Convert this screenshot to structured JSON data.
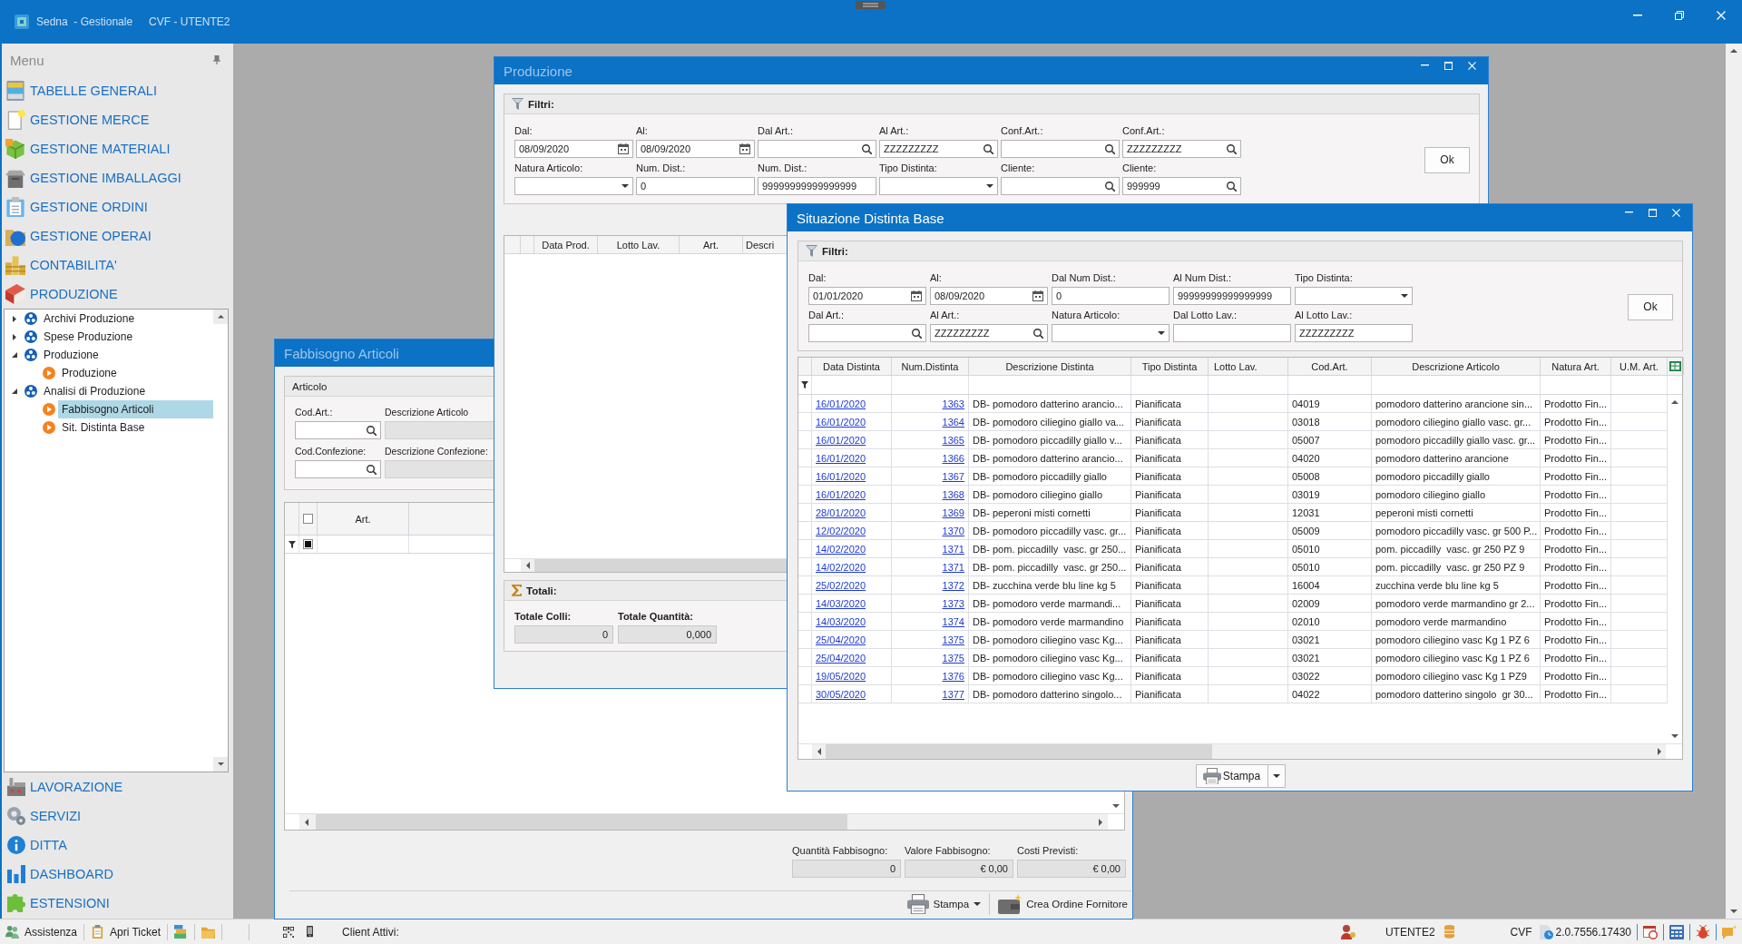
{
  "app_bar": {
    "title": "Sedna  - Gestionale",
    "context": "CVF - UTENTE2"
  },
  "menu": {
    "title": "Menu",
    "sections": [
      "TABELLE GENERALI",
      "GESTIONE MERCE",
      "GESTIONE MATERIALI",
      "GESTIONE IMBALLAGGI",
      "GESTIONE ORDINI",
      "GESTIONE OPERAI",
      "CONTABILITA'",
      "PRODUZIONE"
    ],
    "tree": [
      {
        "label": "Archivi Produzione",
        "kind": "group",
        "expanded": false,
        "selected": false
      },
      {
        "label": "Spese Produzione",
        "kind": "group",
        "expanded": false,
        "selected": false
      },
      {
        "label": "Produzione",
        "kind": "group",
        "expanded": true,
        "selected": false,
        "children": [
          {
            "label": "Produzione",
            "kind": "form",
            "selected": false
          }
        ]
      },
      {
        "label": "Analisi di Produzione",
        "kind": "group",
        "expanded": true,
        "selected": false,
        "children": [
          {
            "label": "Fabbisogno Articoli",
            "kind": "form",
            "selected": true
          },
          {
            "label": "Sit. Distinta Base",
            "kind": "form",
            "selected": false
          }
        ]
      }
    ],
    "more_sections": [
      "LAVORAZIONE",
      "SERVIZI",
      "DITTA",
      "DASHBOARD",
      "ESTENSIONI"
    ]
  },
  "produzione_window": {
    "title": "Produzione",
    "active": false,
    "filters": {
      "title": "Filtri:",
      "fields": [
        {
          "label": "Dal:",
          "value": "08/09/2020",
          "kind": "date"
        },
        {
          "label": "Al:",
          "value": "08/09/2020",
          "kind": "date"
        },
        {
          "label": "Dal Art.:",
          "kind": "search"
        },
        {
          "label": "Al Art.:",
          "value": "ZZZZZZZZZ",
          "kind": "search"
        },
        {
          "label": "Conf.Art.:",
          "kind": "search"
        },
        {
          "label": "Conf.Art.:",
          "value": "ZZZZZZZZZ",
          "kind": "search"
        },
        {
          "label": "Natura Articolo:",
          "kind": "dropdown"
        },
        {
          "label": "Num. Dist.:",
          "value": "0",
          "kind": "text"
        },
        {
          "label": "Num. Dist.:",
          "value": "99999999999999999",
          "kind": "text"
        },
        {
          "label": "Tipo Distinta:",
          "kind": "dropdown"
        },
        {
          "label": "Cliente:",
          "kind": "search"
        },
        {
          "label": "Cliente:",
          "value": "999999",
          "kind": "search"
        }
      ]
    },
    "ok_button": "Ok",
    "grid": {
      "columns": [
        "Data Prod.",
        "Lotto Lav.",
        "Art.",
        "Descri"
      ]
    },
    "totals": {
      "title": "Totali:",
      "fields": [
        {
          "label": "Totale Colli:",
          "value": "0"
        },
        {
          "label": "Totale Quantità:",
          "value": "0,000"
        }
      ]
    }
  },
  "situazione_window": {
    "title": "Situazione Distinta Base",
    "active": true,
    "filters": {
      "title": "Filtri:",
      "fields": [
        {
          "label": "Dal:",
          "value": "01/01/2020",
          "kind": "date"
        },
        {
          "label": "Al:",
          "value": "08/09/2020",
          "kind": "date"
        },
        {
          "label": "Dal Num Dist.:",
          "value": "0",
          "kind": "text"
        },
        {
          "label": "Al Num Dist.:",
          "value": "99999999999999999",
          "kind": "text"
        },
        {
          "label": "Tipo Distinta:",
          "kind": "dropdown"
        },
        {
          "label": "Dal Art.:",
          "kind": "search"
        },
        {
          "label": "Al Art.:",
          "value": "ZZZZZZZZZ",
          "kind": "search"
        },
        {
          "label": "Natura Articolo:",
          "kind": "dropdown"
        },
        {
          "label": "Dal Lotto Lav.:",
          "kind": "text"
        },
        {
          "label": "Al Lotto Lav.:",
          "value": "ZZZZZZZZZ",
          "kind": "text"
        }
      ]
    },
    "ok_button": "Ok",
    "grid": {
      "columns": [
        "Data Distinta",
        "Num.Distinta",
        "Descrizione Distinta",
        "Tipo Distinta",
        "Lotto Lav.",
        "Cod.Art.",
        "Descrizione Articolo",
        "Natura Art.",
        "U.M. Art."
      ],
      "rows": [
        {
          "data": "16/01/2020",
          "num": "1363",
          "descrizione": "DB- pomodoro datterino arancio...",
          "tipo": "Pianificata",
          "cod_art": "04019",
          "descrizione_articolo": "pomodoro datterino arancione sin...",
          "natura": "Prodotto Fin..."
        },
        {
          "data": "16/01/2020",
          "num": "1364",
          "descrizione": "DB- pomodoro ciliegino giallo va...",
          "tipo": "Pianificata",
          "cod_art": "03018",
          "descrizione_articolo": "pomodoro ciliegino giallo vasc. gr...",
          "natura": "Prodotto Fin..."
        },
        {
          "data": "16/01/2020",
          "num": "1365",
          "descrizione": "DB- pomodoro piccadilly giallo v...",
          "tipo": "Pianificata",
          "cod_art": "05007",
          "descrizione_articolo": "pomodoro piccadilly giallo vasc. gr...",
          "natura": "Prodotto Fin..."
        },
        {
          "data": "16/01/2020",
          "num": "1366",
          "descrizione": "DB- pomodoro datterino arancio...",
          "tipo": "Pianificata",
          "cod_art": "04020",
          "descrizione_articolo": "pomodoro datterino arancione",
          "natura": "Prodotto Fin..."
        },
        {
          "data": "16/01/2020",
          "num": "1367",
          "descrizione": "DB- pomodoro piccadilly giallo",
          "tipo": "Pianificata",
          "cod_art": "05008",
          "descrizione_articolo": "pomodoro piccadilly giallo",
          "natura": "Prodotto Fin..."
        },
        {
          "data": "16/01/2020",
          "num": "1368",
          "descrizione": "DB- pomodoro ciliegino giallo",
          "tipo": "Pianificata",
          "cod_art": "03019",
          "descrizione_articolo": "pomodoro ciliegino giallo",
          "natura": "Prodotto Fin..."
        },
        {
          "data": "28/01/2020",
          "num": "1369",
          "descrizione": "DB- peperoni misti cornetti",
          "tipo": "Pianificata",
          "cod_art": "12031",
          "descrizione_articolo": "peperoni misti cornetti",
          "natura": "Prodotto Fin..."
        },
        {
          "data": "12/02/2020",
          "num": "1370",
          "descrizione": "DB- pomodoro piccadilly vasc. gr...",
          "tipo": "Pianificata",
          "cod_art": "05009",
          "descrizione_articolo": "pomodoro piccadilly vasc. gr 500 P...",
          "natura": "Prodotto Fin..."
        },
        {
          "data": "14/02/2020",
          "num": "1371",
          "descrizione": "DB- pom. piccadilly  vasc. gr 250...",
          "tipo": "Pianificata",
          "cod_art": "05010",
          "descrizione_articolo": "pom. piccadilly  vasc. gr 250 PZ 9",
          "natura": "Prodotto Fin..."
        },
        {
          "data": "14/02/2020",
          "num": "1371",
          "descrizione": "DB- pom. piccadilly  vasc. gr 250...",
          "tipo": "Pianificata",
          "cod_art": "05010",
          "descrizione_articolo": "pom. piccadilly  vasc. gr 250 PZ 9",
          "natura": "Prodotto Fin..."
        },
        {
          "data": "25/02/2020",
          "num": "1372",
          "descrizione": "DB- zucchina verde blu line kg 5",
          "tipo": "Pianificata",
          "cod_art": "16004",
          "descrizione_articolo": "zucchina verde blu line kg 5",
          "natura": "Prodotto Fin..."
        },
        {
          "data": "14/03/2020",
          "num": "1373",
          "descrizione": "DB- pomodoro verde marmandi...",
          "tipo": "Pianificata",
          "cod_art": "02009",
          "descrizione_articolo": "pomodoro verde marmandino gr 2...",
          "natura": "Prodotto Fin..."
        },
        {
          "data": "14/03/2020",
          "num": "1374",
          "descrizione": "DB- pomodoro verde marmandino",
          "tipo": "Pianificata",
          "cod_art": "02010",
          "descrizione_articolo": "pomodoro verde marmandino",
          "natura": "Prodotto Fin..."
        },
        {
          "data": "25/04/2020",
          "num": "1375",
          "descrizione": "DB- pomodoro ciliegino vasc Kg...",
          "tipo": "Pianificata",
          "cod_art": "03021",
          "descrizione_articolo": "pomodoro ciliegino vasc Kg 1 PZ 6",
          "natura": "Prodotto Fin..."
        },
        {
          "data": "25/04/2020",
          "num": "1375",
          "descrizione": "DB- pomodoro ciliegino vasc Kg...",
          "tipo": "Pianificata",
          "cod_art": "03021",
          "descrizione_articolo": "pomodoro ciliegino vasc Kg 1 PZ 6",
          "natura": "Prodotto Fin..."
        },
        {
          "data": "19/05/2020",
          "num": "1376",
          "descrizione": "DB- pomodoro ciliegino vasc Kg...",
          "tipo": "Pianificata",
          "cod_art": "03022",
          "descrizione_articolo": "pomodoro ciliegino vasc Kg 1 PZ9",
          "natura": "Prodotto Fin..."
        },
        {
          "data": "30/05/2020",
          "num": "1377",
          "descrizione": "DB- pomodoro datterino singolo...",
          "tipo": "Pianificata",
          "cod_art": "04022",
          "descrizione_articolo": "pomodoro datterino singolo  gr 30...",
          "natura": "Prodotto Fin..."
        }
      ]
    },
    "print_button": "Stampa"
  },
  "fabbisogno_window": {
    "title": "Fabbisogno Articoli",
    "active": false,
    "article_group": {
      "title": "Articolo",
      "fields": [
        {
          "label": "Cod.Art.:",
          "kind": "search",
          "disabled": false
        },
        {
          "label": "Descrizione Articolo",
          "kind": "text",
          "disabled": true
        },
        {
          "label": "Cod.Confezione:",
          "kind": "search",
          "disabled": false
        },
        {
          "label": "Descrizione Confezione:",
          "kind": "text",
          "disabled": true
        }
      ]
    },
    "grid": {
      "columns": [
        "Art."
      ],
      "select_all_checked": false,
      "filter_checkbox_indeterminate": true
    },
    "summary": [
      {
        "label": "Quantità Fabbisogno:",
        "value": "0"
      },
      {
        "label": "Valore Fabbisogno:",
        "value": "€ 0,00"
      },
      {
        "label": "Costi Previsti:",
        "value": "€ 0,00"
      }
    ],
    "buttons": [
      {
        "label": "Stampa",
        "kind": "print"
      },
      {
        "label": "Crea Ordine Fornitore",
        "kind": "order"
      }
    ]
  },
  "status_bar": {
    "left": [
      {
        "label": "Assistenza",
        "kind": "support"
      },
      {
        "label": "Apri Ticket",
        "kind": "ticket"
      }
    ],
    "client_label": "Client Attivi:",
    "user": "UTENTE2",
    "company": "CVF",
    "version": "2.0.7556.17430"
  }
}
